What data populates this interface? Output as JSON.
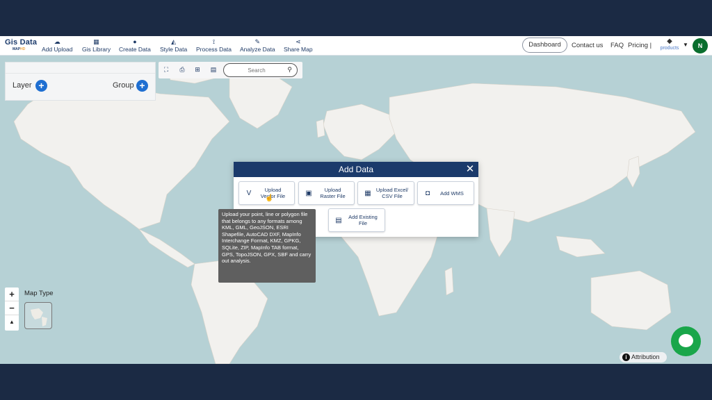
{
  "header": {
    "logo_line1": "Gis Data",
    "logo_line2_a": "MAP",
    "logo_line2_b": "HD",
    "nav": [
      {
        "label": "Add Upload",
        "icon": "cloud-upload-icon"
      },
      {
        "label": "Gis Library",
        "icon": "library-icon"
      },
      {
        "label": "Create Data",
        "icon": "map-pin-icon"
      },
      {
        "label": "Style Data",
        "icon": "paint-bucket-icon"
      },
      {
        "label": "Process Data",
        "icon": "process-icon"
      },
      {
        "label": "Analyze Data",
        "icon": "analyze-icon"
      },
      {
        "label": "Share Map",
        "icon": "share-icon"
      }
    ],
    "dashboard": "Dashboard",
    "contact": "Contact us",
    "faq": "FAQ",
    "pricing": "Pricing |",
    "products": "products",
    "avatar_initial": "N"
  },
  "layer_panel": {
    "layer_label": "Layer",
    "group_label": "Group"
  },
  "tools": {
    "search_placeholder": "Search"
  },
  "map_controls": {
    "zoom_in": "+",
    "zoom_out": "−",
    "compass": "▲",
    "map_type_label": "Map Type"
  },
  "modal": {
    "title": "Add Data",
    "close": "✕",
    "options": [
      {
        "label": "Upload\nVector File",
        "icon": "vector-icon"
      },
      {
        "label": "Upload\nRaster File",
        "icon": "raster-icon"
      },
      {
        "label": "Upload Excel/\nCSV File",
        "icon": "spreadsheet-icon"
      },
      {
        "label": "Add WMS",
        "icon": "wms-icon"
      },
      {
        "label": "Add Existing\nFile",
        "icon": "file-icon"
      }
    ]
  },
  "tooltip": {
    "text": "Upload your point, line or polygon file that belongs to any formats among KML, GML, GeoJSON, ESRI Shapefile, AutoCAD DXF, MapInfo Interchange Format, KMZ, GPKG, SQLite, ZIP, MapInfo TAB format, GPS, TopoJSON, GPX, SBF and carry out analysis."
  },
  "attribution": "Attribution",
  "colors": {
    "brand_navy": "#1b3a6b",
    "accent_blue": "#1f6fd1",
    "chat_green": "#19a64a",
    "map_water": "#b6d1d5",
    "map_land": "#f2f1ee"
  }
}
